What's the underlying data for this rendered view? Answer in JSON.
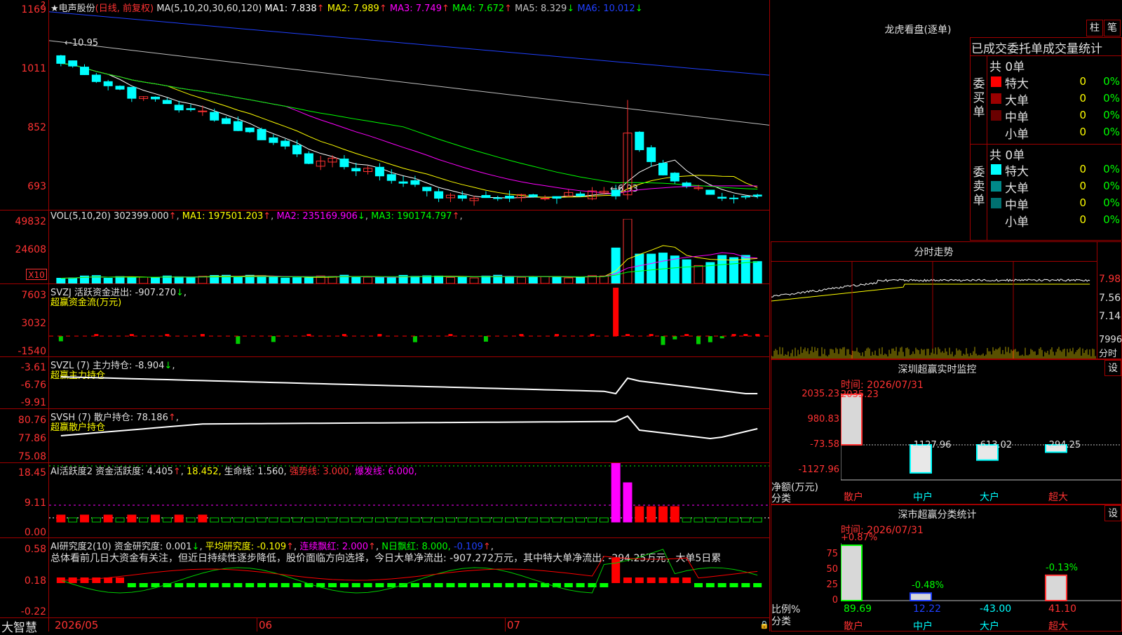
{
  "chart": {
    "stock_name": "电声股份",
    "mode": "(日线, 前复权)",
    "ma_label": "MA(5,10,20,30,60,120)",
    "ma_values": [
      {
        "label": "MA1: 7.838",
        "color": "#ffffff",
        "arrow": "↑"
      },
      {
        "label": "MA2: 7.989",
        "color": "#ffff00",
        "arrow": "↑"
      },
      {
        "label": "MA3: 7.749",
        "color": "#ff00ff",
        "arrow": "↑"
      },
      {
        "label": "MA4: 7.672",
        "color": "#00ff00",
        "arrow": "↑"
      },
      {
        "label": "MA5: 8.329",
        "color": "#c0c0c0",
        "arrow": "↓"
      },
      {
        "label": "MA6: 10.012",
        "color": "#2040ff",
        "arrow": "↓"
      }
    ],
    "price_axis": [
      "1169",
      "1011",
      "852",
      "693"
    ],
    "high_mark": "10.95",
    "low_mark": "6.93",
    "vol_title": "VOL(5,10,20)",
    "vol_value": "302399.000",
    "vol_ma": [
      {
        "label": "MA1: 197501.203",
        "color": "#ffff00",
        "arrow": "↑"
      },
      {
        "label": "MA2: 235169.906",
        "color": "#ff00ff",
        "arrow": "↓"
      },
      {
        "label": "MA3: 190174.797",
        "color": "#00ff00",
        "arrow": "↑"
      }
    ],
    "vol_axis": [
      "49832",
      "24608"
    ],
    "vol_unit": "X10",
    "svzj_title": "SVZJ  活跃资金进出: -907.270",
    "svzj_sub": "超赢资金流(万元)",
    "svzj_axis": [
      "7603",
      "3032",
      "-1540"
    ],
    "svzl_title": "SVZL (7) 主力持仓: -8.904",
    "svzl_sub": "超赢主力持仓",
    "svzl_axis": [
      "-3.61",
      "-6.76",
      "-9.91"
    ],
    "svsh_title": "SVSH (7) 散户持仓: 78.186",
    "svsh_sub": "超赢散户持仓",
    "svsh_axis": [
      "80.76",
      "77.86",
      "75.08"
    ],
    "ai1_title": "AI活跃度2 资金活跃度: 4.405",
    "ai1_v2": "18.452,",
    "ai1_life": "生命线: 1.560,",
    "ai1_strong": "强势线: 3.000,",
    "ai1_burst": "爆发线: 6.000,",
    "ai1_axis": [
      "18.45",
      "9.11",
      "0.00"
    ],
    "ai2_title": "AI研究度2(10) 资金研究度: 0.001",
    "ai2_avg": "平均研究度: -0.109",
    "ai2_streak": "连续飘红: 2.000",
    "ai2_n": "N日飘红: 8.000,",
    "ai2_last": "-0.109",
    "ai2_comment": "总体看前几日大资金有关注，但近日持续性逐步降低，股价面临方向选择，今日大单净流出: -907.272万元，其中特大单净流出: -294.25万元，大单5日累",
    "ai2_axis": [
      "0.58",
      "0.18",
      "-0.22"
    ],
    "date_axis": [
      "2026/05",
      "06",
      "07"
    ],
    "logo": "大智慧"
  },
  "longhu": {
    "title": "龙虎看盘(逐单)",
    "btn_bar": "柱",
    "btn_pen": "笔",
    "tabs": [
      "已成交",
      "委托单",
      "成交量统计"
    ],
    "buy_label": "委买单",
    "sell_label": "委卖单",
    "buy_total": "共 0单",
    "sell_total": "共 0单",
    "buy_rows": [
      {
        "name": "特大",
        "count": "0",
        "pct": "0%",
        "color": "#ff0000"
      },
      {
        "name": "大单",
        "count": "0",
        "pct": "0%",
        "color": "#9a0000"
      },
      {
        "name": "中单",
        "count": "0",
        "pct": "0%",
        "color": "#6a0000"
      },
      {
        "name": "小单",
        "count": "0",
        "pct": "0%",
        "color": "#000000"
      }
    ],
    "sell_rows": [
      {
        "name": "特大",
        "count": "0",
        "pct": "0%",
        "color": "#00ffff"
      },
      {
        "name": "大单",
        "count": "0",
        "pct": "0%",
        "color": "#008a8a"
      },
      {
        "name": "中单",
        "count": "0",
        "pct": "0%",
        "color": "#007070"
      },
      {
        "name": "小单",
        "count": "0",
        "pct": "0%",
        "color": "#000000"
      }
    ]
  },
  "intraday": {
    "title": "分时走势",
    "axis": [
      "7.98",
      "7.56",
      "7.14"
    ],
    "vol_label": "7996",
    "vol_unit": "分时"
  },
  "sz_monitor": {
    "title": "深圳超赢实时监控",
    "btn": "设",
    "time": "时间: 2026/07/31",
    "axis": [
      "2035.23",
      "980.83",
      "-73.58",
      "-1127.96"
    ],
    "y_label": "净额(万元)",
    "cat_label": "分类",
    "bars": [
      {
        "name": "散户",
        "value": "2035.23"
      },
      {
        "name": "中户",
        "value": "-1127.96"
      },
      {
        "name": "大户",
        "value": "-613.02"
      },
      {
        "name": "超大",
        "value": "-294.25"
      }
    ]
  },
  "sz_category": {
    "title": "深市超赢分类统计",
    "btn": "设",
    "time": "时间: 2026/07/31",
    "axis": [
      "75",
      "50",
      "25",
      "0"
    ],
    "y_label": "比例%",
    "cat_label": "分类",
    "bars": [
      {
        "name": "散户",
        "top": "+0.87%",
        "bottom": "89.69"
      },
      {
        "name": "中户",
        "top": "-0.48%",
        "bottom": "12.22"
      },
      {
        "name": "大户",
        "top": "",
        "bottom": "-43.00"
      },
      {
        "name": "超大",
        "top": "-0.13%",
        "bottom": "41.10"
      }
    ]
  },
  "colors": {
    "up": "#ff3232",
    "down": "#00ffff",
    "grid": "#a00000",
    "accent_yellow": "#ffff00"
  }
}
